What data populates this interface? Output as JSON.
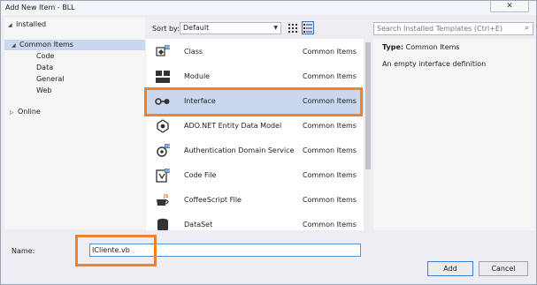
{
  "window": {
    "title": "Add New Item - BLL",
    "close_glyph": "✕"
  },
  "tree": {
    "items": [
      {
        "label": "Installed",
        "arrow": "◢"
      },
      {
        "label": "Common Items",
        "arrow": "◢"
      },
      {
        "label": "Code",
        "arrow": ""
      },
      {
        "label": "Data",
        "arrow": ""
      },
      {
        "label": "General",
        "arrow": ""
      },
      {
        "label": "Web",
        "arrow": ""
      },
      {
        "label": "Online",
        "arrow": "▷"
      }
    ]
  },
  "toolbar": {
    "sort_label": "Sort by:",
    "sort_value": "Default",
    "dropdown_glyph": "▼"
  },
  "search": {
    "placeholder": "Search Installed Templates (Ctrl+E)",
    "icon": "search-icon",
    "glyph": "⌕"
  },
  "templates": [
    {
      "name": "Class",
      "category": "Common Items",
      "icon": "class-icon"
    },
    {
      "name": "Module",
      "category": "Common Items",
      "icon": "module-icon"
    },
    {
      "name": "Interface",
      "category": "Common Items",
      "icon": "interface-icon"
    },
    {
      "name": "ADO.NET Entity Data Model",
      "category": "Common Items",
      "icon": "entity-model-icon"
    },
    {
      "name": "Authentication Domain Service",
      "category": "Common Items",
      "icon": "domain-service-icon"
    },
    {
      "name": "Code File",
      "category": "Common Items",
      "icon": "code-file-icon"
    },
    {
      "name": "CoffeeScript File",
      "category": "Common Items",
      "icon": "coffeescript-icon"
    },
    {
      "name": "DataSet",
      "category": "Common Items",
      "icon": "dataset-icon"
    }
  ],
  "details": {
    "type_label": "Type:",
    "type_value": "Common Items",
    "description": "An empty interface definition"
  },
  "name_field": {
    "label": "Name:",
    "value": "ICliente.vb"
  },
  "buttons": {
    "add": "Add",
    "cancel": "Cancel"
  },
  "colors": {
    "highlight": "#f0802a",
    "selection": "#c9d8ee",
    "accent": "#3c7fd2"
  }
}
